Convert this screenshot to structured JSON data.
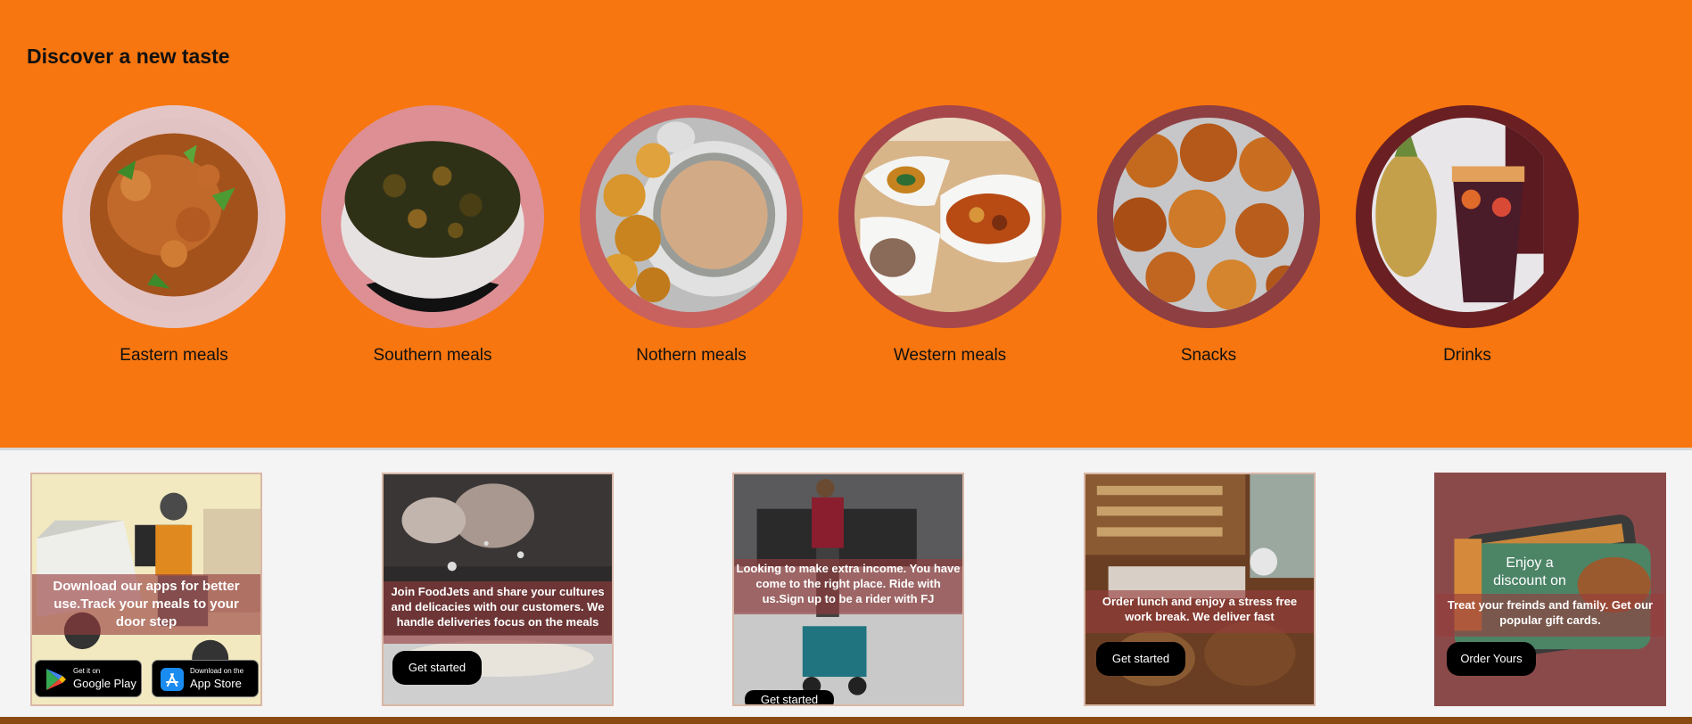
{
  "discover": {
    "title": "Discover a new taste",
    "categories": [
      {
        "label": "Eastern meals",
        "ring_color": "#e4c5c6"
      },
      {
        "label": "Southern meals",
        "ring_color": "#dd8f93"
      },
      {
        "label": "Nothern meals",
        "ring_color": "#c7625f"
      },
      {
        "label": "Western meals",
        "ring_color": "#a6474b"
      },
      {
        "label": "Snacks",
        "ring_color": "#8e3f42"
      },
      {
        "label": "Drinks",
        "ring_color": "#6a1f22"
      }
    ]
  },
  "cards": {
    "apps": {
      "text": "Download our apps for better use.Track your meals to your door step",
      "google_small": "Get it on",
      "google_big": "Google Play",
      "apple_small": "Download on the",
      "apple_big": "App Store"
    },
    "vendor": {
      "text": "Join FoodJets and share your cultures and delicacies with our customers. We handle deliveries focus on the meals",
      "button": "Get started"
    },
    "rider": {
      "text": "Looking to make extra income. You have come to the right place. Ride with us.Sign up to be a rider with FJ",
      "button": "Get started"
    },
    "lunch": {
      "text": "Order lunch and enjoy a stress free work break. We deliver fast",
      "button": "Get started"
    },
    "gift": {
      "text": "Treat your freinds and family. Get our popular gift cards.",
      "button": "Order Yours",
      "card_text": "Enjoy a discount on"
    }
  }
}
